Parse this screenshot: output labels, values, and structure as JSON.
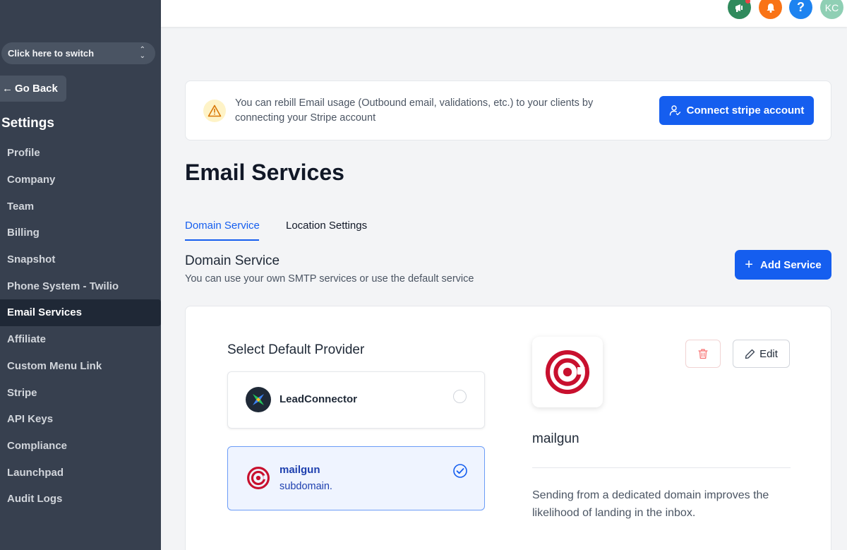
{
  "sidebar": {
    "switcher_label": "Click here to switch",
    "go_back_label": "Go Back",
    "settings_title": "Settings",
    "items": [
      {
        "label": "Profile"
      },
      {
        "label": "Company"
      },
      {
        "label": "Team"
      },
      {
        "label": "Billing"
      },
      {
        "label": "Snapshot"
      },
      {
        "label": "Phone System - Twilio"
      },
      {
        "label": "Email Services",
        "active": true
      },
      {
        "label": "Affiliate"
      },
      {
        "label": "Custom Menu Link"
      },
      {
        "label": "Stripe"
      },
      {
        "label": "API Keys"
      },
      {
        "label": "Compliance"
      },
      {
        "label": "Launchpad"
      },
      {
        "label": "Audit Logs"
      }
    ],
    "background_color": "#37404f",
    "active_color": "#1f2836"
  },
  "topbar": {
    "icons": [
      "megaphone-icon",
      "bell-icon",
      "help-icon"
    ],
    "help_glyph": "?",
    "avatar_initials": "KC",
    "colors": {
      "megaphone": "#2f8a5c",
      "bell": "#f97316",
      "help": "#1d83f0",
      "avatar": "#8fcfb4"
    }
  },
  "banner": {
    "text": "You can rebill Email usage (Outbound email, validations, etc.) to your clients by connecting your Stripe account",
    "button_label": "Connect stripe account"
  },
  "page": {
    "title": "Email Services",
    "tabs": [
      {
        "label": "Domain Service",
        "active": true
      },
      {
        "label": "Location Settings",
        "active": false
      }
    ],
    "section_title": "Domain Service",
    "section_subtitle": "You can use your own SMTP services or use the default service",
    "add_service_label": "Add Service",
    "accent_color": "#155eef"
  },
  "providers": {
    "title": "Select Default Provider",
    "items": [
      {
        "name": "LeadConnector",
        "selected": false
      },
      {
        "name": "mailgun",
        "subtitle": "subdomain.",
        "selected": true
      }
    ]
  },
  "detail": {
    "name": "mailgun",
    "edit_label": "Edit",
    "description": "Sending from a dedicated domain improves the likelihood of landing in the inbox."
  }
}
